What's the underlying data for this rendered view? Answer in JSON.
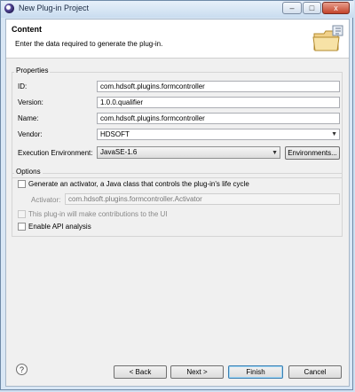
{
  "window": {
    "title": "New Plug-in Project",
    "controls": [
      "–",
      "□",
      "x"
    ]
  },
  "header": {
    "title": "Content",
    "description": "Enter the data required to generate the plug-in.",
    "icon": "folder-wizard-icon"
  },
  "properties": {
    "group_title": "Properties",
    "id_label": "ID:",
    "id_value": "com.hdsoft.plugins.formcontroller",
    "version_label": "Version:",
    "version_value": "1.0.0.qualifier",
    "name_label": "Name:",
    "name_value": "com.hdsoft.plugins.formcontroller",
    "vendor_label": "Vendor:",
    "vendor_value": "HDSOFT",
    "env_label": "Execution Environment:",
    "env_value": "JavaSE-1.6",
    "env_button": "Environments..."
  },
  "options": {
    "group_title": "Options",
    "generate_activator_label": "Generate an activator, a Java class that controls the plug-in's life cycle",
    "generate_activator_checked": false,
    "activator_label": "Activator:",
    "activator_value": "com.hdsoft.plugins.formcontroller.Activator",
    "ui_contrib_label": "This plug-in will make contributions to the UI",
    "ui_contrib_checked": false,
    "api_analysis_label": "Enable API analysis",
    "api_analysis_checked": false
  },
  "footer": {
    "help": "?",
    "back": "< Back",
    "next": "Next >",
    "finish": "Finish",
    "cancel": "Cancel"
  }
}
